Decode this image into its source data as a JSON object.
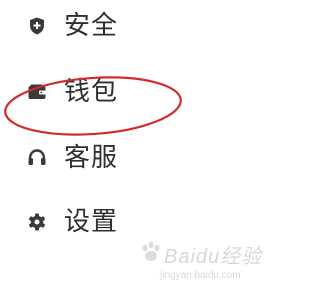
{
  "menu": {
    "items": [
      {
        "icon": "shield-icon",
        "label": "安全"
      },
      {
        "icon": "wallet-icon",
        "label": "钱包"
      },
      {
        "icon": "headset-icon",
        "label": "客服"
      },
      {
        "icon": "gear-icon",
        "label": "设置"
      }
    ]
  },
  "annotation": {
    "shape": "ellipse",
    "target": "钱包",
    "color": "#d32a2a"
  },
  "watermark": {
    "brand": "Baidu经验",
    "url": "jingyan.baidu.com"
  },
  "colors": {
    "text": "#2f2f2f",
    "icon": "#3a3a3a",
    "background": "#ffffff"
  }
}
